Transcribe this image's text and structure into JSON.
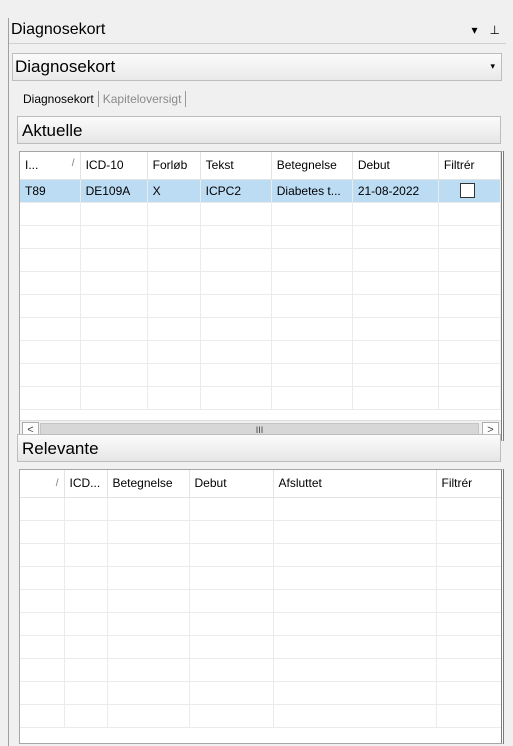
{
  "window": {
    "title": "Diagnosekort",
    "btn_dropdown": "▾",
    "btn_pin": "⊥"
  },
  "subheader": {
    "title": "Diagnosekort",
    "arrow": "▾"
  },
  "tabs": [
    {
      "label": "Diagnosekort",
      "active": true
    },
    {
      "label": "Kapiteloversigt",
      "active": false
    }
  ],
  "aktuelle": {
    "title": "Aktuelle",
    "columns": [
      "I...",
      "ICD-10",
      "Forløb",
      "Tekst",
      "Betegnelse",
      "Debut",
      "Filtrér"
    ],
    "rows": [
      {
        "c1": "T89",
        "c2": "DE109A",
        "c3": "X",
        "c4": "ICPC2",
        "c5": "Diabetes t...",
        "c6": "21-08-2022"
      }
    ],
    "scroll_thumb": "III"
  },
  "relevante": {
    "title": "Relevante",
    "columns": [
      "",
      "ICD...",
      "Betegnelse",
      "Debut",
      "Afsluttet",
      "Filtrér"
    ]
  }
}
